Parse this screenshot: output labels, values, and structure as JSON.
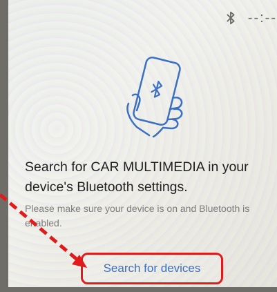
{
  "status_bar": {
    "bluetooth_icon": "bluetooth-icon",
    "clock_text": "--:--"
  },
  "illustration": {
    "icon": "phone-in-hand-bluetooth-icon"
  },
  "main": {
    "title": "Search for CAR MULTIMEDIA in your device's Bluetooth settings.",
    "subtitle": "Please make sure your device is on and Bluetooth is enabled."
  },
  "actions": {
    "search_button_label": "Search for devices"
  },
  "colors": {
    "accent_blue": "#3b6fc4",
    "highlight_red": "#e01b1b"
  }
}
